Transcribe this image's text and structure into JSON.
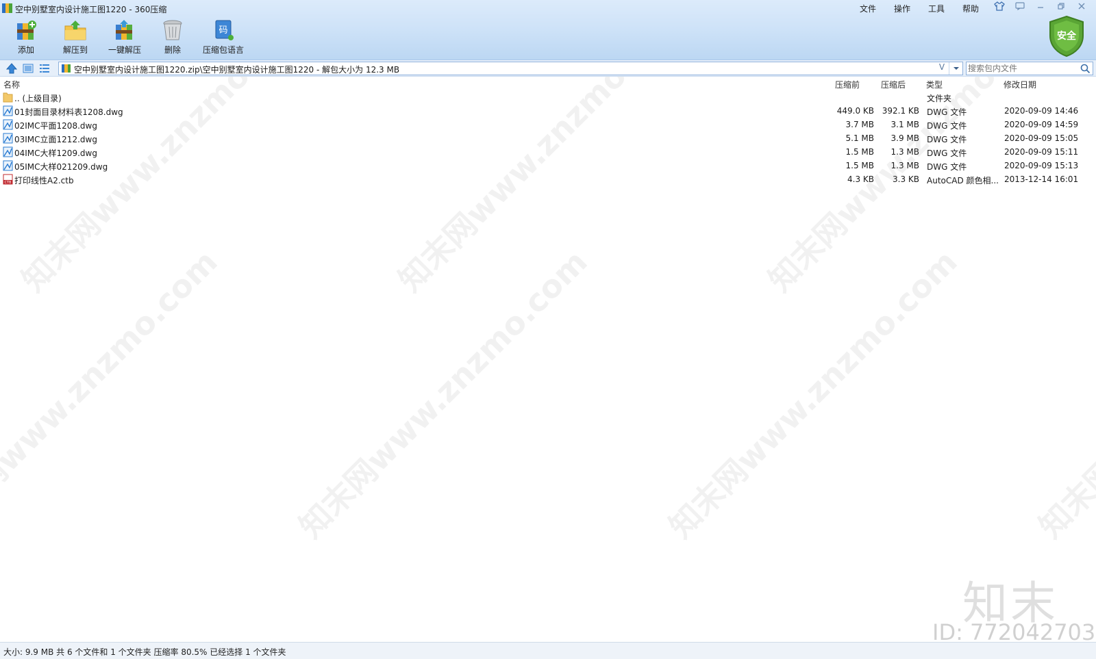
{
  "window": {
    "title": "空中别墅室内设计施工图1220 - 360压缩",
    "menu": [
      "文件",
      "操作",
      "工具",
      "帮助"
    ]
  },
  "toolbar": {
    "buttons": [
      {
        "label": "添加",
        "icon": "add-archive-icon"
      },
      {
        "label": "解压到",
        "icon": "extract-to-icon"
      },
      {
        "label": "一键解压",
        "icon": "one-click-extract-icon"
      },
      {
        "label": "删除",
        "icon": "trash-icon"
      },
      {
        "label": "压缩包语言",
        "icon": "archive-language-icon"
      }
    ],
    "language_icon_char": "码",
    "security_label": "安全"
  },
  "address": {
    "path": "空中别墅室内设计施工图1220.zip\\空中别墅室内设计施工图1220 - 解包大小为 12.3 MB",
    "v_glyph": "V",
    "search_placeholder": "搜索包内文件"
  },
  "columns": {
    "name": "名称",
    "before": "压缩前",
    "after": "压缩后",
    "type": "类型",
    "date": "修改日期"
  },
  "files": [
    {
      "name": ".. (上级目录)",
      "before": "",
      "after": "",
      "type": "文件夹",
      "date": "",
      "icon": "folder-icon"
    },
    {
      "name": "01封面目录材料表1208.dwg",
      "before": "449.0 KB",
      "after": "392.1 KB",
      "type": "DWG 文件",
      "date": "2020-09-09 14:46",
      "icon": "dwg-file-icon"
    },
    {
      "name": "02IMC平面1208.dwg",
      "before": "3.7 MB",
      "after": "3.1 MB",
      "type": "DWG 文件",
      "date": "2020-09-09 14:59",
      "icon": "dwg-file-icon"
    },
    {
      "name": "03IMC立面1212.dwg",
      "before": "5.1 MB",
      "after": "3.9 MB",
      "type": "DWG 文件",
      "date": "2020-09-09 15:05",
      "icon": "dwg-file-icon"
    },
    {
      "name": "04IMC大样1209.dwg",
      "before": "1.5 MB",
      "after": "1.3 MB",
      "type": "DWG 文件",
      "date": "2020-09-09 15:11",
      "icon": "dwg-file-icon"
    },
    {
      "name": "05IMC大样021209.dwg",
      "before": "1.5 MB",
      "after": "1.3 MB",
      "type": "DWG 文件",
      "date": "2020-09-09 15:13",
      "icon": "dwg-file-icon"
    },
    {
      "name": "打印线性A2.ctb",
      "before": "4.3 KB",
      "after": "3.3 KB",
      "type": "AutoCAD 颜色相...",
      "date": "2013-12-14 16:01",
      "icon": "ctb-file-icon"
    }
  ],
  "ctb_icon_text": "CTB",
  "status": "大小: 9.9 MB 共 6 个文件和 1 个文件夹 压缩率 80.5% 已经选择 1 个文件夹",
  "watermark": {
    "text": "知末网www.znzmo.com",
    "brand": "知末",
    "id": "ID: 772042703"
  },
  "colors": {
    "toolbar_bg": "#cfe3f8",
    "shield": "#5aa535",
    "dwg_icon": "#2a7bd1",
    "ctb_icon": "#c0282e",
    "folder": "#f3c96a"
  }
}
